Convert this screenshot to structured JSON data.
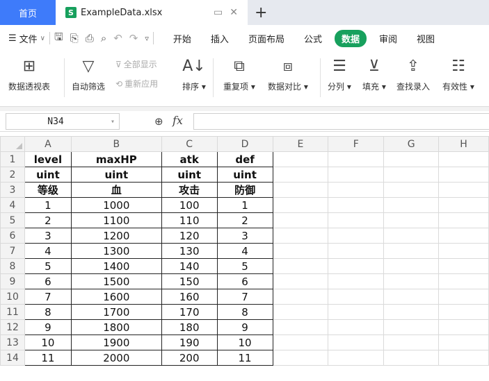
{
  "tabs": {
    "home": "首页",
    "file_badge": "S",
    "file_name": "ExampleData.xlsx",
    "add": "+"
  },
  "menu": {
    "file": "文件",
    "tabs": [
      "开始",
      "插入",
      "页面布局",
      "公式",
      "数据",
      "审阅",
      "视图"
    ],
    "active_tab": "数据"
  },
  "ribbon": {
    "pivot": "数据透视表",
    "autofilter": "自动筛选",
    "show_all": "全部显示",
    "reapply": "重新应用",
    "sort": "排序",
    "duplicates": "重复项",
    "compare": "数据对比",
    "split": "分列",
    "fill": "填充",
    "lookup": "查找录入",
    "validity": "有效性"
  },
  "formula_bar": {
    "cell_ref": "N34",
    "fx": "fx",
    "formula": ""
  },
  "columns": [
    "A",
    "B",
    "C",
    "D",
    "E",
    "F",
    "G",
    "H"
  ],
  "rows": [
    [
      "level",
      "maxHP",
      "atk",
      "def"
    ],
    [
      "uint",
      "uint",
      "uint",
      "uint"
    ],
    [
      "等级",
      "血",
      "攻击",
      "防御"
    ],
    [
      "1",
      "1000",
      "100",
      "1"
    ],
    [
      "2",
      "1100",
      "110",
      "2"
    ],
    [
      "3",
      "1200",
      "120",
      "3"
    ],
    [
      "4",
      "1300",
      "130",
      "4"
    ],
    [
      "5",
      "1400",
      "140",
      "5"
    ],
    [
      "6",
      "1500",
      "150",
      "6"
    ],
    [
      "7",
      "1600",
      "160",
      "7"
    ],
    [
      "8",
      "1700",
      "170",
      "8"
    ],
    [
      "9",
      "1800",
      "180",
      "9"
    ],
    [
      "10",
      "1900",
      "190",
      "10"
    ],
    [
      "11",
      "2000",
      "200",
      "11"
    ]
  ],
  "colors": {
    "home_tab": "#3e7bfa",
    "active_menu": "#17a05d",
    "xls_badge": "#17a05d"
  }
}
